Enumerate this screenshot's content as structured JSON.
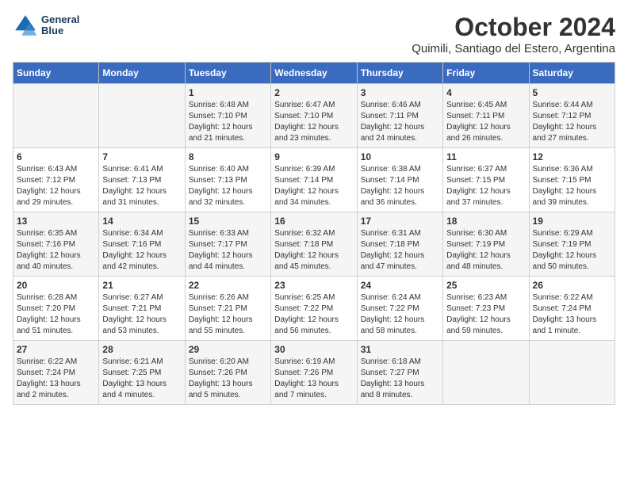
{
  "header": {
    "logo_line1": "General",
    "logo_line2": "Blue",
    "title": "October 2024",
    "subtitle": "Quimili, Santiago del Estero, Argentina"
  },
  "calendar": {
    "days_of_week": [
      "Sunday",
      "Monday",
      "Tuesday",
      "Wednesday",
      "Thursday",
      "Friday",
      "Saturday"
    ],
    "weeks": [
      [
        {
          "day": "",
          "info": ""
        },
        {
          "day": "",
          "info": ""
        },
        {
          "day": "1",
          "info": "Sunrise: 6:48 AM\nSunset: 7:10 PM\nDaylight: 12 hours and 21 minutes."
        },
        {
          "day": "2",
          "info": "Sunrise: 6:47 AM\nSunset: 7:10 PM\nDaylight: 12 hours and 23 minutes."
        },
        {
          "day": "3",
          "info": "Sunrise: 6:46 AM\nSunset: 7:11 PM\nDaylight: 12 hours and 24 minutes."
        },
        {
          "day": "4",
          "info": "Sunrise: 6:45 AM\nSunset: 7:11 PM\nDaylight: 12 hours and 26 minutes."
        },
        {
          "day": "5",
          "info": "Sunrise: 6:44 AM\nSunset: 7:12 PM\nDaylight: 12 hours and 27 minutes."
        }
      ],
      [
        {
          "day": "6",
          "info": "Sunrise: 6:43 AM\nSunset: 7:12 PM\nDaylight: 12 hours and 29 minutes."
        },
        {
          "day": "7",
          "info": "Sunrise: 6:41 AM\nSunset: 7:13 PM\nDaylight: 12 hours and 31 minutes."
        },
        {
          "day": "8",
          "info": "Sunrise: 6:40 AM\nSunset: 7:13 PM\nDaylight: 12 hours and 32 minutes."
        },
        {
          "day": "9",
          "info": "Sunrise: 6:39 AM\nSunset: 7:14 PM\nDaylight: 12 hours and 34 minutes."
        },
        {
          "day": "10",
          "info": "Sunrise: 6:38 AM\nSunset: 7:14 PM\nDaylight: 12 hours and 36 minutes."
        },
        {
          "day": "11",
          "info": "Sunrise: 6:37 AM\nSunset: 7:15 PM\nDaylight: 12 hours and 37 minutes."
        },
        {
          "day": "12",
          "info": "Sunrise: 6:36 AM\nSunset: 7:15 PM\nDaylight: 12 hours and 39 minutes."
        }
      ],
      [
        {
          "day": "13",
          "info": "Sunrise: 6:35 AM\nSunset: 7:16 PM\nDaylight: 12 hours and 40 minutes."
        },
        {
          "day": "14",
          "info": "Sunrise: 6:34 AM\nSunset: 7:16 PM\nDaylight: 12 hours and 42 minutes."
        },
        {
          "day": "15",
          "info": "Sunrise: 6:33 AM\nSunset: 7:17 PM\nDaylight: 12 hours and 44 minutes."
        },
        {
          "day": "16",
          "info": "Sunrise: 6:32 AM\nSunset: 7:18 PM\nDaylight: 12 hours and 45 minutes."
        },
        {
          "day": "17",
          "info": "Sunrise: 6:31 AM\nSunset: 7:18 PM\nDaylight: 12 hours and 47 minutes."
        },
        {
          "day": "18",
          "info": "Sunrise: 6:30 AM\nSunset: 7:19 PM\nDaylight: 12 hours and 48 minutes."
        },
        {
          "day": "19",
          "info": "Sunrise: 6:29 AM\nSunset: 7:19 PM\nDaylight: 12 hours and 50 minutes."
        }
      ],
      [
        {
          "day": "20",
          "info": "Sunrise: 6:28 AM\nSunset: 7:20 PM\nDaylight: 12 hours and 51 minutes."
        },
        {
          "day": "21",
          "info": "Sunrise: 6:27 AM\nSunset: 7:21 PM\nDaylight: 12 hours and 53 minutes."
        },
        {
          "day": "22",
          "info": "Sunrise: 6:26 AM\nSunset: 7:21 PM\nDaylight: 12 hours and 55 minutes."
        },
        {
          "day": "23",
          "info": "Sunrise: 6:25 AM\nSunset: 7:22 PM\nDaylight: 12 hours and 56 minutes."
        },
        {
          "day": "24",
          "info": "Sunrise: 6:24 AM\nSunset: 7:22 PM\nDaylight: 12 hours and 58 minutes."
        },
        {
          "day": "25",
          "info": "Sunrise: 6:23 AM\nSunset: 7:23 PM\nDaylight: 12 hours and 59 minutes."
        },
        {
          "day": "26",
          "info": "Sunrise: 6:22 AM\nSunset: 7:24 PM\nDaylight: 13 hours and 1 minute."
        }
      ],
      [
        {
          "day": "27",
          "info": "Sunrise: 6:22 AM\nSunset: 7:24 PM\nDaylight: 13 hours and 2 minutes."
        },
        {
          "day": "28",
          "info": "Sunrise: 6:21 AM\nSunset: 7:25 PM\nDaylight: 13 hours and 4 minutes."
        },
        {
          "day": "29",
          "info": "Sunrise: 6:20 AM\nSunset: 7:26 PM\nDaylight: 13 hours and 5 minutes."
        },
        {
          "day": "30",
          "info": "Sunrise: 6:19 AM\nSunset: 7:26 PM\nDaylight: 13 hours and 7 minutes."
        },
        {
          "day": "31",
          "info": "Sunrise: 6:18 AM\nSunset: 7:27 PM\nDaylight: 13 hours and 8 minutes."
        },
        {
          "day": "",
          "info": ""
        },
        {
          "day": "",
          "info": ""
        }
      ]
    ]
  }
}
